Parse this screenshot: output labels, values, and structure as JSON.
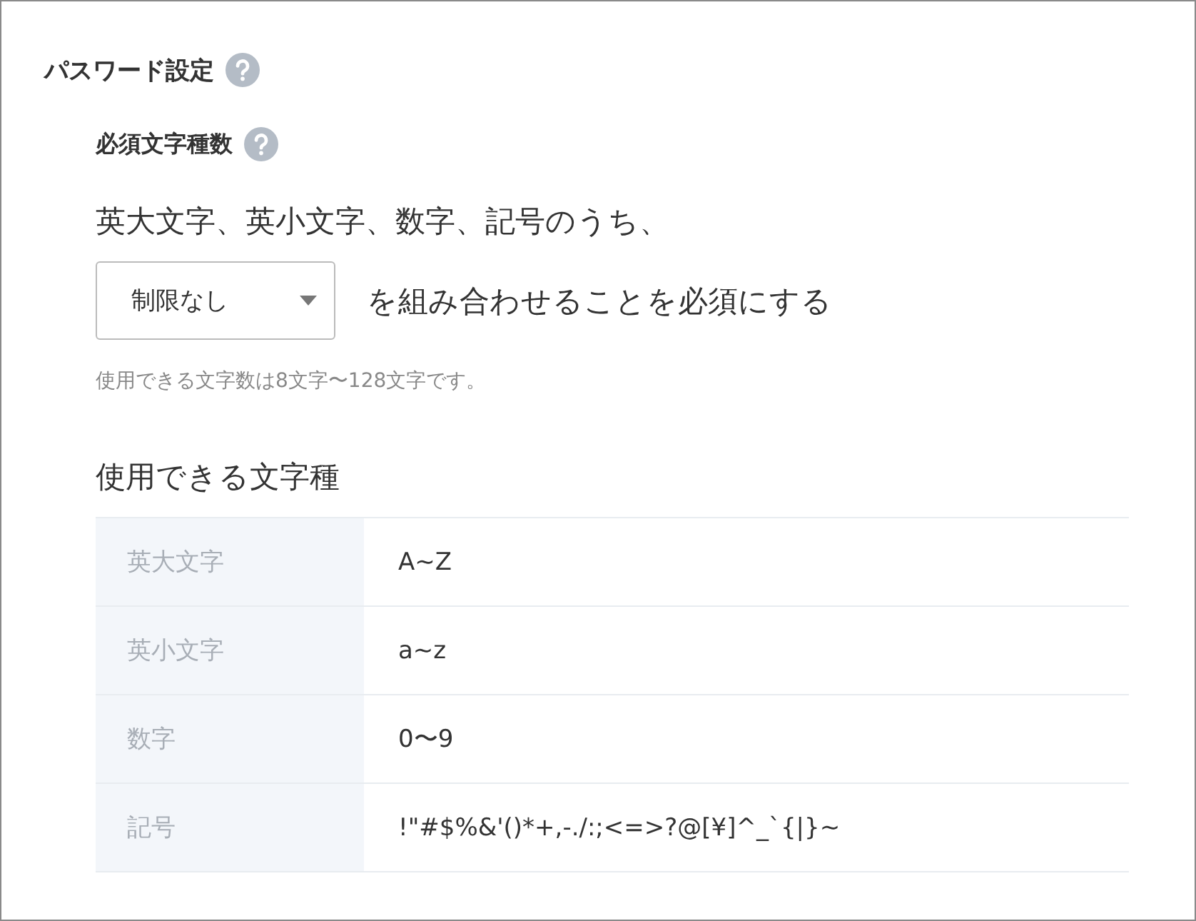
{
  "section": {
    "title": "パスワード設定"
  },
  "subsection": {
    "title": "必須文字種数"
  },
  "rule": {
    "lead": "英大文字、英小文字、数字、記号のうち、",
    "select": {
      "value": "制限なし"
    },
    "tail": "を組み合わせることを必須にする"
  },
  "hint": "使用できる文字数は8文字〜128文字です。",
  "charset": {
    "title": "使用できる文字種",
    "rows": [
      {
        "label": "英大文字",
        "value": "A~Z"
      },
      {
        "label": "英小文字",
        "value": "a~z"
      },
      {
        "label": "数字",
        "value": "0〜9"
      },
      {
        "label": "記号",
        "value": "!\"#$%&'()*+,-./:;<=>?@[¥]^_`{|}~"
      }
    ]
  }
}
